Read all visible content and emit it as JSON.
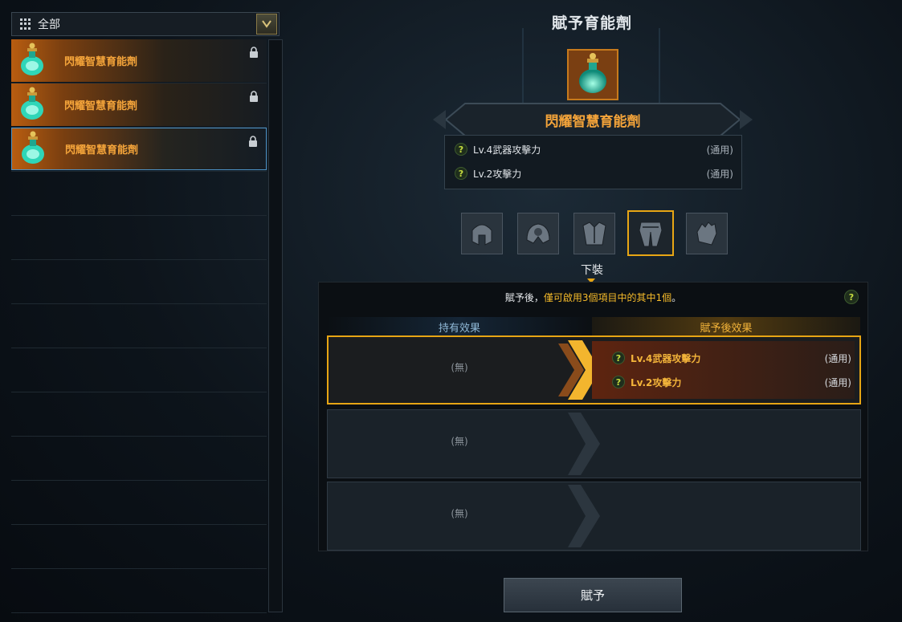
{
  "filter": {
    "label": "全部",
    "icon": "grid-icon",
    "dropdown_icon": "chevron-down-icon"
  },
  "item_list": [
    {
      "name": "閃耀智慧育能劑",
      "icon": "potion-icon",
      "lock_icon": "lock-icon",
      "selected": false
    },
    {
      "name": "閃耀智慧育能劑",
      "icon": "potion-icon",
      "lock_icon": "lock-icon",
      "selected": false
    },
    {
      "name": "閃耀智慧育能劑",
      "icon": "potion-icon",
      "lock_icon": "lock-icon",
      "selected": true
    }
  ],
  "panel": {
    "title": "賦予育能劑",
    "item_name": "閃耀智慧育能劑",
    "effects": [
      {
        "text": "Lv.4武器攻擊力",
        "scope": "(通用)"
      },
      {
        "text": "Lv.2攻擊力",
        "scope": "(通用)"
      }
    ]
  },
  "equipment_slots": [
    {
      "icon": "helmet-icon",
      "active": false
    },
    {
      "icon": "shoulder-armor-icon",
      "active": false
    },
    {
      "icon": "chest-armor-icon",
      "active": false
    },
    {
      "icon": "leg-armor-icon",
      "active": true
    },
    {
      "icon": "gauntlet-icon",
      "active": false
    }
  ],
  "selected_slot_label": "下裝",
  "options": {
    "notice_prefix": "賦予後，",
    "notice_highlight": "僅可啟用3個項目中的其中1個",
    "notice_suffix": "。",
    "help_icon": "question-icon",
    "col_current": "持有效果",
    "col_after": "賦予後效果",
    "rows": [
      {
        "current": "(無)",
        "selected": true,
        "after": [
          {
            "text": "Lv.4武器攻擊力",
            "scope": "(通用)"
          },
          {
            "text": "Lv.2攻擊力",
            "scope": "(通用)"
          }
        ]
      },
      {
        "current": "(無)",
        "selected": false,
        "after": []
      },
      {
        "current": "(無)",
        "selected": false,
        "after": []
      }
    ]
  },
  "grant_button": "賦予",
  "colors": {
    "accent_orange": "#f4a43a",
    "highlight_yellow": "#e7a514",
    "selection_blue": "#4d93c7"
  }
}
